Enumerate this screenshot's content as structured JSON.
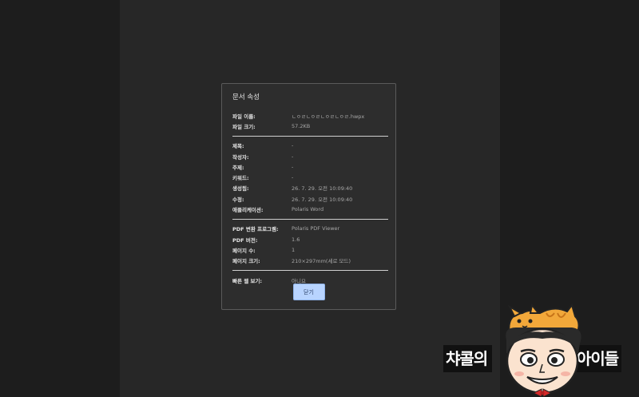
{
  "dialog": {
    "title": "문서 속성",
    "file_rows": [
      {
        "label": "파일 이름:",
        "value": "ㄴㅇㄹㄴㅇㄹㄴㅇㄹㄴㅇㄹ.hwpx"
      },
      {
        "label": "파일 크기:",
        "value": "57.2KB"
      }
    ],
    "meta_rows": [
      {
        "label": "제목:",
        "value": "-"
      },
      {
        "label": "작성자:",
        "value": "-"
      },
      {
        "label": "주제:",
        "value": "-"
      },
      {
        "label": "키워드:",
        "value": "-"
      },
      {
        "label": "생성됨:",
        "value": "26. 7. 29. 오전 10:09:40"
      },
      {
        "label": "수정:",
        "value": "26. 7. 29. 오전 10:09:40"
      },
      {
        "label": "애플리케이션:",
        "value": "Polaris Word"
      }
    ],
    "pdf_rows": [
      {
        "label": "PDF 변환 프로그램:",
        "value": "Polaris PDF Viewer"
      },
      {
        "label": "PDF 버전:",
        "value": "1.6"
      },
      {
        "label": "페이지 수:",
        "value": "1"
      },
      {
        "label": "페이지 크기:",
        "value": "210×297mm(세로 모드)"
      }
    ],
    "web_rows": [
      {
        "label": "빠른 웹 보기:",
        "value": "아니요"
      }
    ],
    "close_label": "닫기"
  },
  "watermark": {
    "text_left": "챠콜의",
    "text_right": "아이들"
  },
  "colors": {
    "accent_button": "#b8d4ff",
    "dialog_bg": "#2d2d2d"
  }
}
